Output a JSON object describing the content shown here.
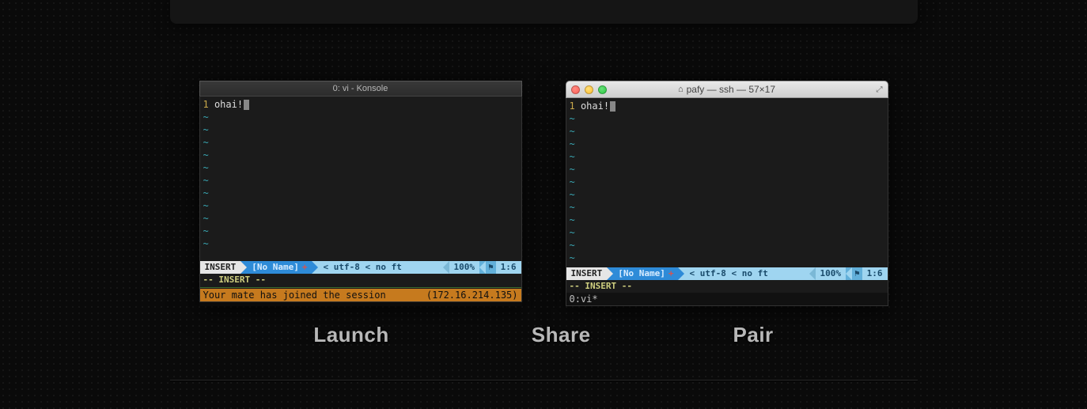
{
  "linux": {
    "title": "0: vi - Konsole",
    "lineno": "1",
    "content": " ohai!",
    "airline": {
      "mode": "INSERT",
      "file": "[No Name]",
      "plus": "+",
      "enc_sep": "<",
      "enc": "utf-8",
      "ft_sep": "<",
      "ft": "no ft",
      "pct": "100%",
      "flag": "⚑",
      "pos": "1:6"
    },
    "insert_msg": "-- INSERT --",
    "notice_left": "Your mate has joined the session",
    "notice_right": "(172.16.214.135)"
  },
  "mac": {
    "title": "pafy — ssh — 57×17",
    "lineno": "1",
    "content": " ohai!",
    "airline": {
      "mode": "INSERT",
      "file": "[No Name]",
      "plus": "+",
      "enc_sep": "<",
      "enc": "utf-8",
      "ft_sep": "<",
      "ft": "no ft",
      "pct": "100%",
      "flag": "⚑",
      "pos": "1:6"
    },
    "insert_msg": "-- INSERT --",
    "tmux_status": "0:vi*"
  },
  "labels": {
    "launch": "Launch",
    "share": "Share",
    "pair": "Pair"
  },
  "tilde_rows_linux": 11,
  "tilde_rows_mac": 13
}
